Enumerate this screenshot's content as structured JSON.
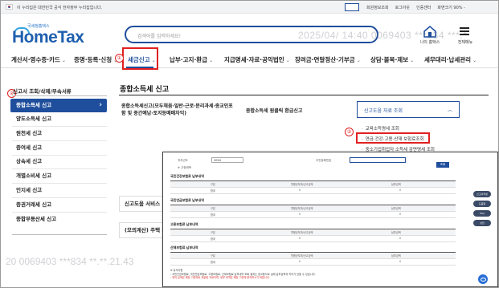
{
  "topbar": {
    "gov_text": "이 누리집은 대한민국 공식 전자정부 누리집입니다.",
    "links": [
      "회원정보조회",
      "로그아웃",
      "인증센터",
      "화면크기 90% -"
    ]
  },
  "header": {
    "logo_small": "국세청홈택스",
    "logo": "HomeTax",
    "search_placeholder": "검색어를 입력하세요!",
    "watermark": "2025/04/ 14:40 0069403 ***834 ***.*",
    "my_home": "나의 홈택스",
    "all_menu": "전체메뉴"
  },
  "nav": {
    "items": [
      {
        "label": "계산서·영수증·카드",
        "chev": "⌄"
      },
      {
        "label": "증명·등록·신청",
        "chev": "⌄"
      },
      {
        "label": "세금신고",
        "chev": "⌄"
      },
      {
        "label": "납부·고지·환급",
        "chev": "⌄"
      },
      {
        "label": "지급명세·자료·공익법인",
        "chev": "⌄"
      },
      {
        "label": "장려금·연말정산·기부금",
        "chev": "⌄"
      },
      {
        "label": "상담·불복·제보",
        "chev": "⌄"
      },
      {
        "label": "세무대리·납세관리",
        "chev": "⌄"
      }
    ]
  },
  "badges": [
    "①",
    "②",
    "③"
  ],
  "sidebar": {
    "head": "신고서 조회/삭제/부속서류",
    "items": [
      "종합소득세 신고",
      "양도소득세 신고",
      "원천세 신고",
      "증여세 신고",
      "상속세 신고",
      "개별소비세 신고",
      "인지세 신고",
      "증권거래세 신고",
      "종합부동산세 신고"
    ]
  },
  "main": {
    "title": "종합소득세 신고",
    "cell1": "종합소득세신고(모두채움·일반·근로·분리과세·종교인포함 및 중간예납·토지등매매차익)",
    "cell2": "종합소득세 원클릭 환급신고",
    "select_label": "신고도움 자료 조회",
    "dropdown": [
      "교육소득명세 조회",
      "연금·건강·고용·산재 보험료조회",
      "중소기업취업자 소득세 감면명세 조회"
    ],
    "card1": "신고도움 서비스",
    "card2": "(모의계산) 주택 건",
    "watermark": "20 0069403 ***834 **.**.21.43"
  },
  "overlay": {
    "label1": "귀속년도",
    "year": "2024",
    "label2": "주민등록번호",
    "label3": "※ 고정제목",
    "button": "조회",
    "sections": [
      "국민건강보험료 납부내역",
      "국민연금보험료 납부내역",
      "고용보험료 납부내역",
      "산재보험료 납부내역"
    ],
    "col_head": [
      "구분",
      "월평균부과/신고금액",
      "납부금액"
    ],
    "row_vals": [
      "합계",
      "0",
      "0"
    ],
    "note_head": "※ 유의사항",
    "note1": "- 국민건강보험료, 국민연금보험료, 고용보험료, 산재보험료 납부내역 조회 결과는 참고용으로 실제 납부금액과 차이가 있을 수 있습니다.",
    "note2": "- 위의 금액은 해당 기관에서 제공한 자료이며, 세부 내역은 해당 기관에 문의하시기 바랍니다.",
    "side_buttons": [
      "신고서작성",
      "도움말",
      "FAQ",
      "상담"
    ]
  }
}
